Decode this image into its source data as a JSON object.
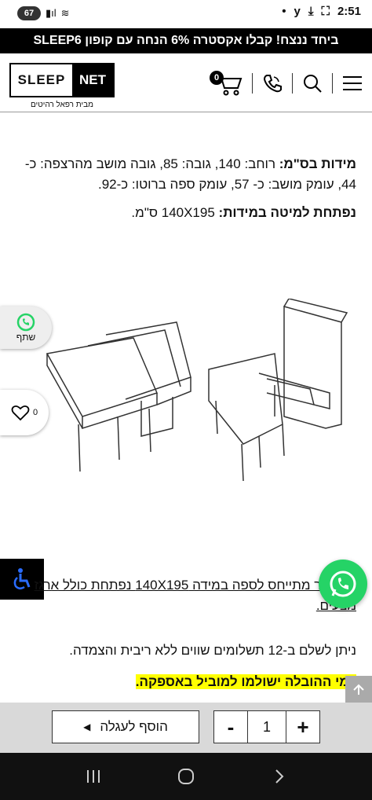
{
  "status_bar": {
    "battery": "67",
    "time": "2:51"
  },
  "promo_banner": "ביחד ננצח! קבלו אקסטרה 6% הנחה עם קופון SLEEP6",
  "header": {
    "logo_left": "SLEEP",
    "logo_right": "NET",
    "logo_sub": "מבית רפאל רהיטים",
    "cart_count": "0"
  },
  "content": {
    "dimensions_label": "מידות בס\"מ:",
    "dimensions_text": " רוחב: 140, גובה: 85, גובה מושב מהרצפה: כ- 44, עומק מושב: כ- 57, עומק ספה ברוטו: כ-92.",
    "bed_label": "נפתחת למיטה במידות:",
    "bed_text": " 140X195 ס\"מ."
  },
  "side": {
    "share_label": "שתף",
    "like_count": "0"
  },
  "note_text": "*המחיר מתייחס לספה במידה 140X195 נפתחת כולל ארגז מצעים.",
  "installments_text": "ניתן לשלם ב-12 תשלומים שווים ללא ריבית והצמדה.",
  "delivery_text": "דמי ההובלה ישולמו למוביל באספקה.",
  "footer": {
    "add_to_cart": "הוסף לעגלה",
    "quantity": "1",
    "minus": "-",
    "plus": "+"
  },
  "colors": {
    "whatsapp": "#25d366",
    "highlight": "#ffff00",
    "promo_bg": "#000000"
  }
}
